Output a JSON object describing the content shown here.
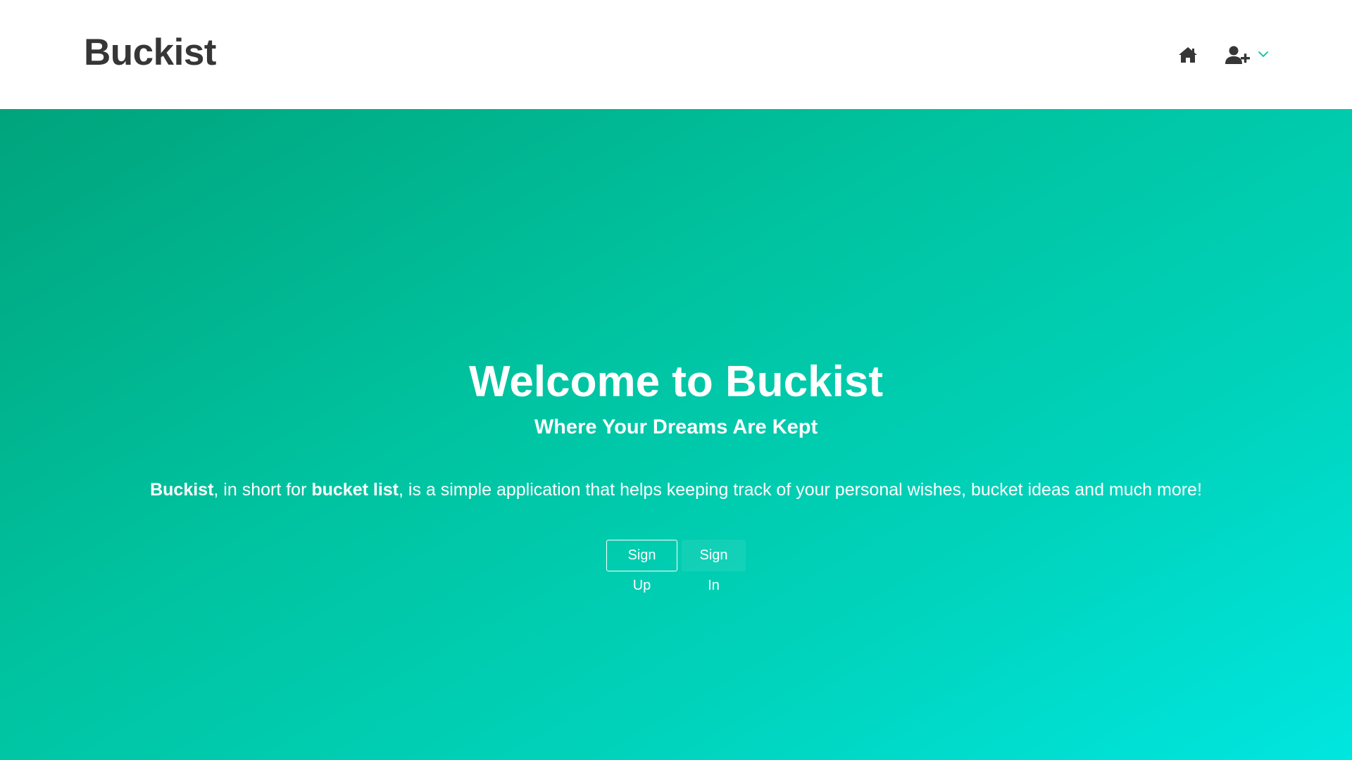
{
  "navbar": {
    "brand": "Buckist",
    "home_icon": "home-icon",
    "user_icon": "user-plus-icon",
    "dropdown_icon": "chevron-down-icon",
    "accent_color": "#00c3a0"
  },
  "hero": {
    "title": "Welcome to Buckist",
    "subtitle": "Where Your Dreams Are Kept",
    "description": {
      "brand": "Buckist",
      "part1": ", in short for ",
      "term": "bucket list",
      "part2": ", is a simple application that helps keeping track of your personal wishes, bucket ideas and much more!"
    },
    "signup_label": "Sign Up",
    "signin_label": "Sign In",
    "gradient_start": "#00a47c",
    "gradient_end": "#00e6e0"
  }
}
